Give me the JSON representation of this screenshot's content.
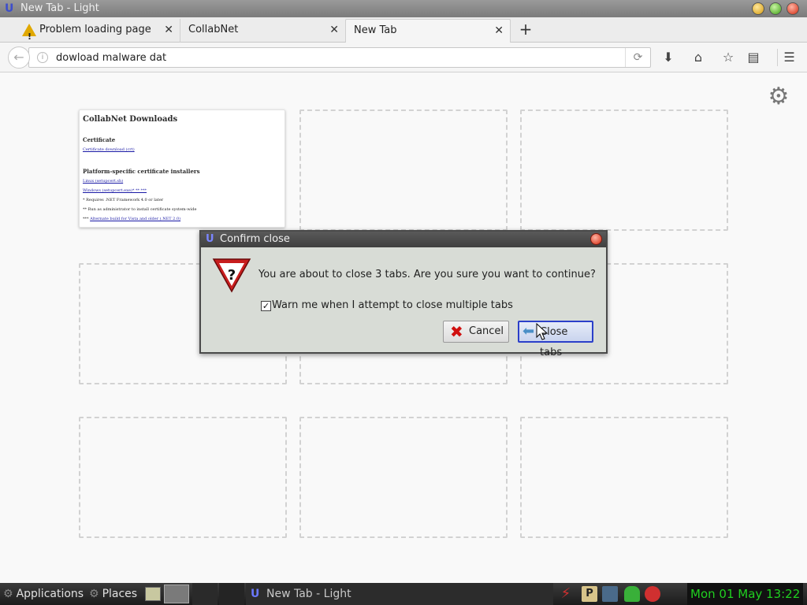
{
  "window": {
    "title": "New Tab - Light"
  },
  "tabs": [
    {
      "label": "Problem loading page",
      "icon": "warning-icon"
    },
    {
      "label": "CollabNet"
    },
    {
      "label": "New Tab",
      "active": true
    }
  ],
  "navbar": {
    "url_value": "dowload malware dat"
  },
  "thumbnail": {
    "title": "CollabNet Downloads",
    "section1": "Certificate",
    "link1": "Certificate download (crt)",
    "section2": "Platform-specific certificate installers",
    "link2": "Linux (setupcert.sh)",
    "link3": "Windows (setupcert.exe)* ** ***",
    "note1": "* Requires .NET Framework 4.0 or later",
    "note2": "** Run as administrator to install certificate system-wide",
    "note3_prefix": "***",
    "note3_link": "Alternate build for Vista and older (.NET 2.0)"
  },
  "dialog": {
    "title": "Confirm close",
    "message": "You are about to close 3 tabs. Are you sure you want to continue?",
    "checkbox_label": "Warn me when I attempt to close multiple tabs",
    "checkbox_checked": true,
    "cancel_label": "Cancel",
    "confirm_label": "Close tabs"
  },
  "taskbar": {
    "applications_label": "Applications",
    "places_label": "Places",
    "window_label": "New Tab - Light",
    "clock": "Mon 01 May 13:22"
  }
}
